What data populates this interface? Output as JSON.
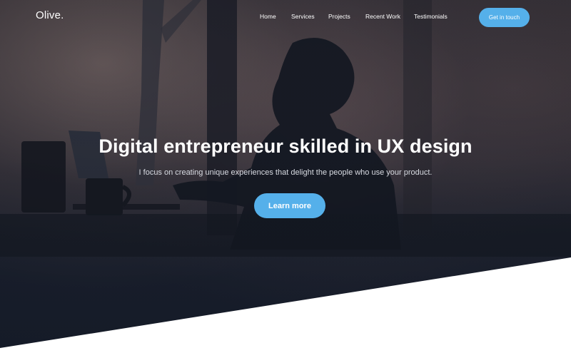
{
  "brand": {
    "logo_text": "Olive."
  },
  "nav": {
    "items": [
      {
        "label": "Home"
      },
      {
        "label": "Services"
      },
      {
        "label": "Projects"
      },
      {
        "label": "Recent Work"
      },
      {
        "label": "Testimonials"
      }
    ],
    "cta_label": "Get in touch"
  },
  "hero": {
    "title": "Digital entrepreneur skilled in UX design",
    "subtitle": "I focus on creating unique experiences that delight the people who use your product.",
    "button_label": "Learn more"
  },
  "colors": {
    "accent": "#55b0ea",
    "text_light": "#ffffff",
    "section_bg": "#ffffff"
  },
  "background": {
    "icon": "hero-photo"
  }
}
